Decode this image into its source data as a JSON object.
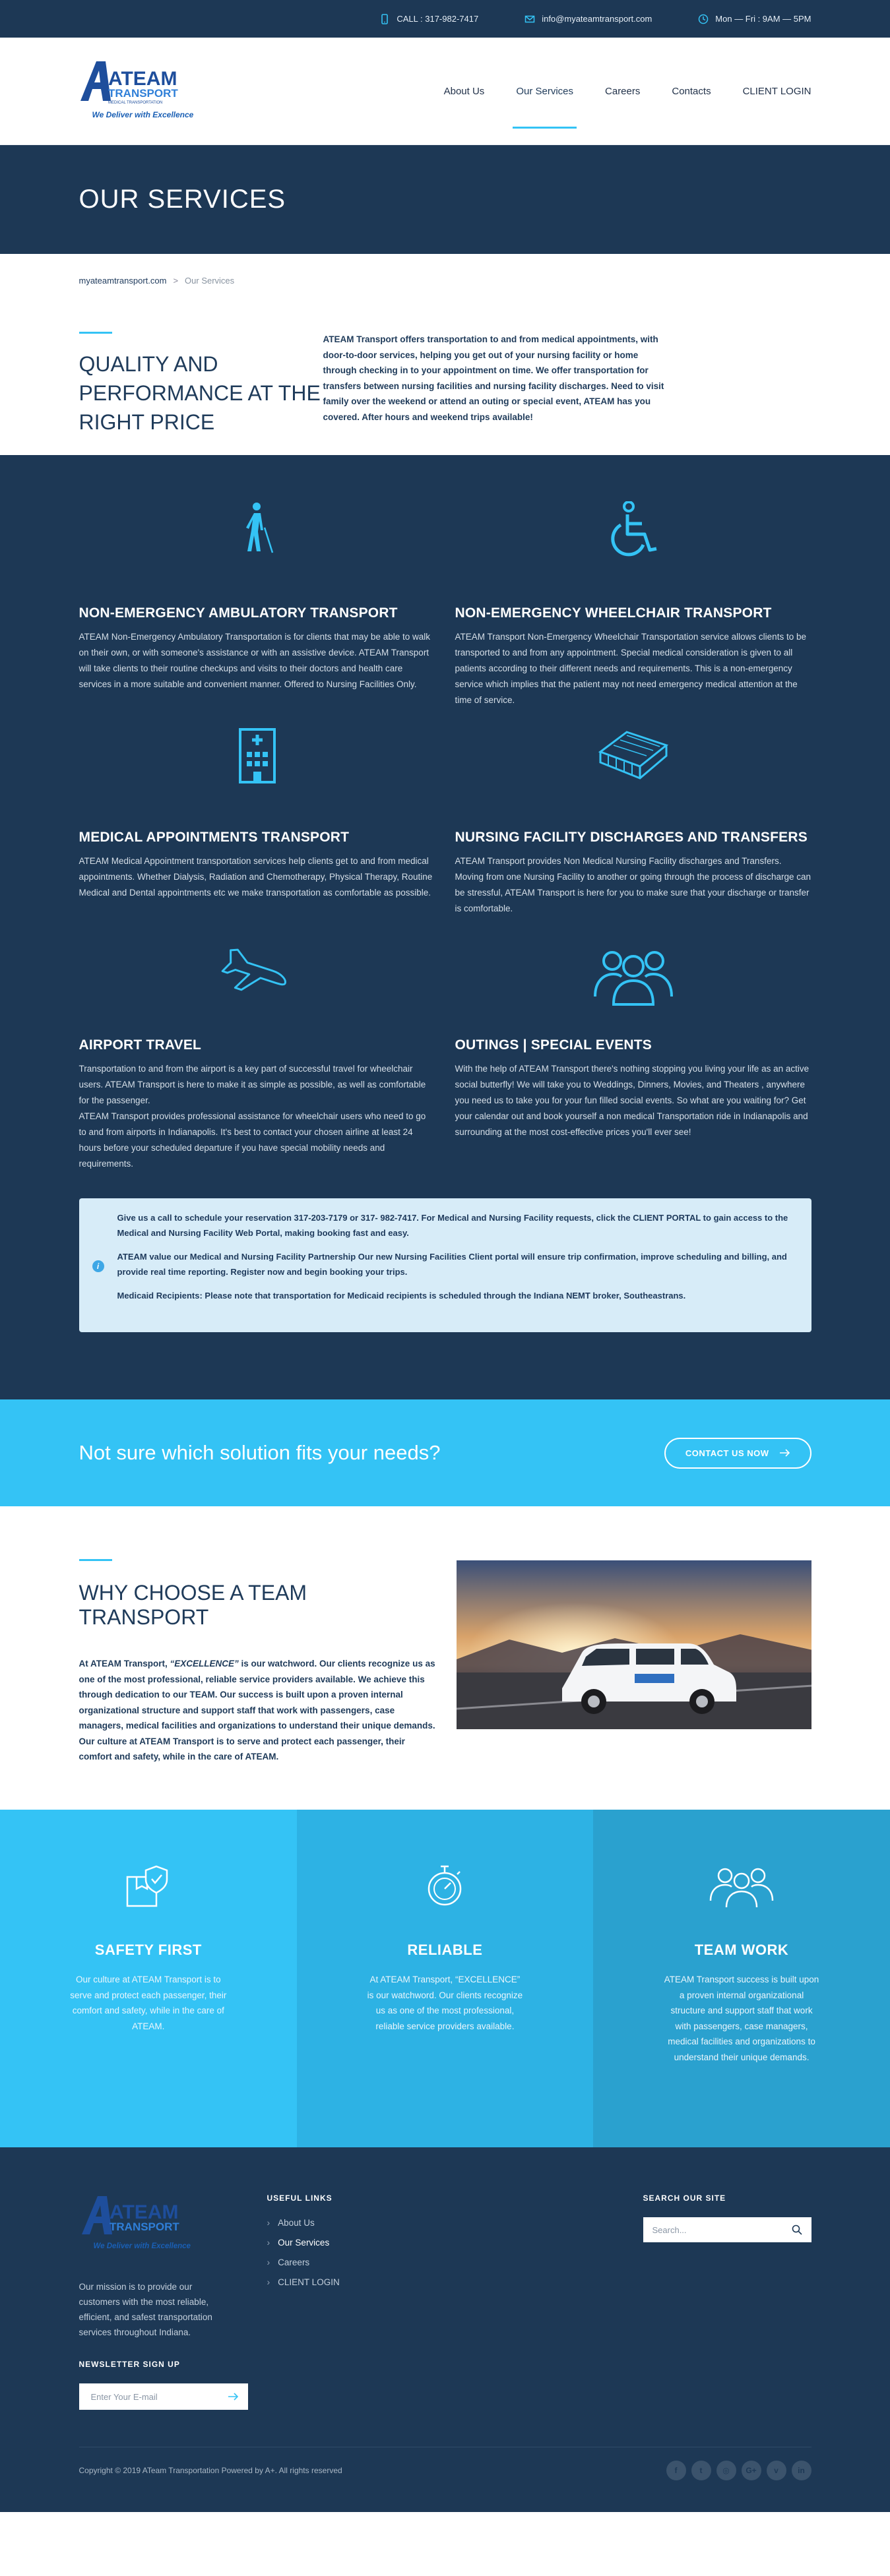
{
  "topbar": {
    "phone": "CALL : 317-982-7417",
    "email": "info@myateamtransport.com",
    "hours": "Mon — Fri : 9AM — 5PM"
  },
  "logo": {
    "word_top": "ATEAM",
    "word_bottom": "TRANSPORT",
    "small": "MEDICAL TRANSPORTATION",
    "tagline": "We Deliver with Excellence"
  },
  "nav": {
    "items": [
      {
        "label": "About Us"
      },
      {
        "label": "Our Services"
      },
      {
        "label": "Careers"
      },
      {
        "label": "Contacts"
      },
      {
        "label": "CLIENT LOGIN"
      }
    ]
  },
  "page": {
    "title": "OUR SERVICES"
  },
  "breadcrumb": {
    "home": "myateamtransport.com",
    "separator": ">",
    "current": "Our Services"
  },
  "intro": {
    "heading": "QUALITY AND PERFORMANCE AT THE RIGHT PRICE",
    "text": "ATEAM Transport offers transportation to and from medical appointments, with door-to-door services, helping you get out of your nursing facility or home through checking in to your appointment on time. We offer transportation for transfers between nursing facilities and nursing facility discharges. Need to visit family over the weekend or attend an outing or special event, ATEAM has you covered. After hours and weekend trips available!"
  },
  "services": [
    {
      "icon": "walking-cane-icon",
      "title": "NON-EMERGENCY AMBULATORY TRANSPORT",
      "text": "ATEAM Non-Emergency Ambulatory Transportation is for clients that may be able to walk on their own, or with someone's assistance or with an assistive device. ATEAM Transport will take clients to their routine checkups and visits to their doctors and health care services in a more suitable and convenient manner. Offered to Nursing Facilities Only."
    },
    {
      "icon": "wheelchair-icon",
      "title": "NON-EMERGENCY WHEELCHAIR TRANSPORT",
      "text": "ATEAM Transport Non-Emergency Wheelchair Transportation service allows clients to be transported to and from any appointment. Special medical consideration is given to all patients according to their different needs and requirements. This is a non-emergency service which implies that the patient may not need emergency medical attention at the time of service."
    },
    {
      "icon": "hospital-building-icon",
      "title": "MEDICAL APPOINTMENTS TRANSPORT",
      "text": "ATEAM Medical Appointment transportation services help clients get to and from medical appointments. Whether Dialysis, Radiation and Chemotherapy, Physical Therapy, Routine Medical and Dental appointments etc we make transportation as comfortable as possible."
    },
    {
      "icon": "facility-icon",
      "title": "NURSING FACILITY DISCHARGES AND TRANSFERS",
      "text": "ATEAM Transport provides Non Medical Nursing Facility discharges and Transfers. Moving from one Nursing Facility to another or going through the process of discharge can be stressful, ATEAM Transport is here for you to make sure that your discharge or transfer is comfortable."
    },
    {
      "icon": "airplane-icon",
      "title": "AIRPORT TRAVEL",
      "text": "Transportation to and from the airport is a key part of successful travel for wheelchair users. ATEAM Transport is here to make it as simple as possible, as well as comfortable for the passenger.\nATEAM Transport provides professional assistance for wheelchair users who need to go to and from airports in Indianapolis. It's best to contact your chosen airline at least 24 hours before your scheduled departure if you have special mobility needs and requirements."
    },
    {
      "icon": "group-icon",
      "title": "OUTINGS | SPECIAL EVENTS",
      "text": "With the help of ATEAM Transport there's nothing stopping you living your life as an active social butterfly! We will take you to Weddings, Dinners, Movies, and Theaters , anywhere you need us to take you for your fun filled social events. So what are you waiting for? Get your calendar out and book yourself a non medical Transportation ride in Indianapolis and surrounding at the most cost-effective prices you'll ever see!"
    }
  ],
  "info": {
    "p1": "Give us a call to schedule your reservation 317-203-7179 or 317- 982-7417. For Medical and Nursing Facility requests, click the CLIENT PORTAL to gain access to the Medical and Nursing Facility Web Portal, making booking fast and easy.",
    "p2": "ATEAM value our Medical and Nursing Facility Partnership Our new Nursing Facilities Client portal will ensure trip confirmation, improve scheduling and billing, and provide real time reporting. Register now and begin booking your trips.",
    "p3": "Medicaid Recipients: Please note that transportation for Medicaid recipients is scheduled through the Indiana NEMT broker, Southeastrans."
  },
  "cta": {
    "heading": "Not sure which solution fits your needs?",
    "button": "CONTACT US NOW"
  },
  "why": {
    "heading": "WHY CHOOSE A TEAM TRANSPORT",
    "text_a": "At ATEAM Transport, ",
    "text_em": "“EXCELLENCE”",
    "text_b": " is our watchword. Our clients recognize us as one of the most professional, reliable service providers available. We achieve this through dedication to our TEAM. Our success is built upon a proven internal organizational structure and support staff that work with passengers, case managers, medical facilities and organizations to understand their unique demands. Our culture at ATEAM Transport is to serve and protect each passenger, their comfort and safety, while in the care of ATEAM."
  },
  "features": [
    {
      "icon": "shield-box-icon",
      "title": "SAFETY FIRST",
      "text": "Our culture at ATEAM Transport is to serve and protect each passenger, their comfort and safety, while in the care of ATEAM."
    },
    {
      "icon": "stopwatch-icon",
      "title": "RELIABLE",
      "text": "At ATEAM Transport, “EXCELLENCE” is our watchword. Our clients recognize us as one of the most professional, reliable service providers available."
    },
    {
      "icon": "team-icon",
      "title": "TEAM WORK",
      "text": "ATEAM Transport success is built upon a proven internal organizational structure and support staff that work with passengers, case managers, medical facilities and organizations to understand their unique demands."
    }
  ],
  "footer": {
    "mission": "Our mission is to provide our customers with the most reliable, efficient, and safest transportation services throughout Indiana.",
    "newsletter_title": "NEWSLETTER SIGN UP",
    "newsletter_placeholder": "Enter Your E-mail",
    "links_title": "USEFUL LINKS",
    "links": [
      {
        "label": "About Us"
      },
      {
        "label": "Our Services"
      },
      {
        "label": "Careers"
      },
      {
        "label": "CLIENT LOGIN"
      }
    ],
    "search_title": "SEARCH OUR SITE",
    "search_placeholder": "Search...",
    "copyright": "Copyright © 2019 ATeam Transportation Powered by A+. All rights reserved",
    "socials": [
      {
        "icon": "facebook-icon",
        "glyph": "f"
      },
      {
        "icon": "twitter-icon",
        "glyph": "t"
      },
      {
        "icon": "instagram-icon",
        "glyph": "◎"
      },
      {
        "icon": "googleplus-icon",
        "glyph": "G+"
      },
      {
        "icon": "vimeo-icon",
        "glyph": "v"
      },
      {
        "icon": "linkedin-icon",
        "glyph": "in"
      }
    ]
  },
  "colors": {
    "navy": "#1d3855",
    "accent": "#34c3f5",
    "info_bg": "#d7ecf8"
  }
}
